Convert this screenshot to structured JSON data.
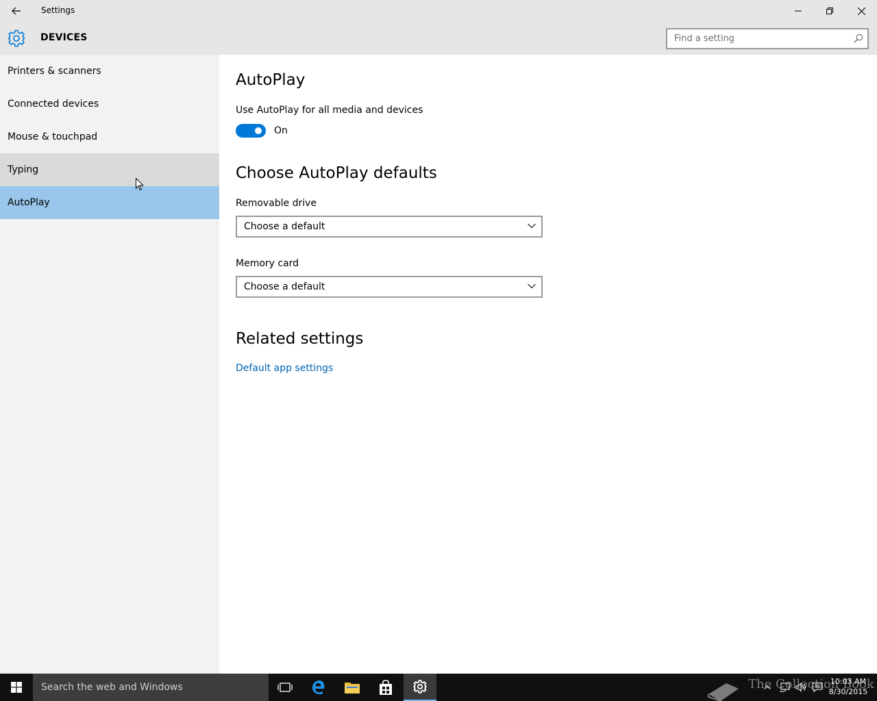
{
  "window": {
    "title": "Settings",
    "controls": {
      "minimize": "minimize-icon",
      "maximize": "restore-icon",
      "close": "close-icon"
    }
  },
  "header": {
    "section": "DEVICES",
    "search_placeholder": "Find a setting"
  },
  "sidebar": {
    "items": [
      {
        "label": "Printers & scanners"
      },
      {
        "label": "Connected devices"
      },
      {
        "label": "Mouse & touchpad"
      },
      {
        "label": "Typing"
      },
      {
        "label": "AutoPlay"
      }
    ],
    "hovered": "Typing",
    "selected": "AutoPlay"
  },
  "main": {
    "title": "AutoPlay",
    "use_autoplay_label": "Use AutoPlay for all media and devices",
    "toggle_state": "On",
    "defaults_title": "Choose AutoPlay defaults",
    "removable_label": "Removable drive",
    "removable_value": "Choose a default",
    "memory_label": "Memory card",
    "memory_value": "Choose a default",
    "related_title": "Related settings",
    "related_link": "Default app settings"
  },
  "taskbar": {
    "search_text": "Search the web and Windows",
    "watermark": "The Collection Book",
    "time": "10:03 AM",
    "date": "8/30/2015"
  },
  "colors": {
    "accent": "#0078d7",
    "selected_nav": "#99c6ea",
    "link": "#0063b1",
    "chrome": "#e6e6e6"
  }
}
